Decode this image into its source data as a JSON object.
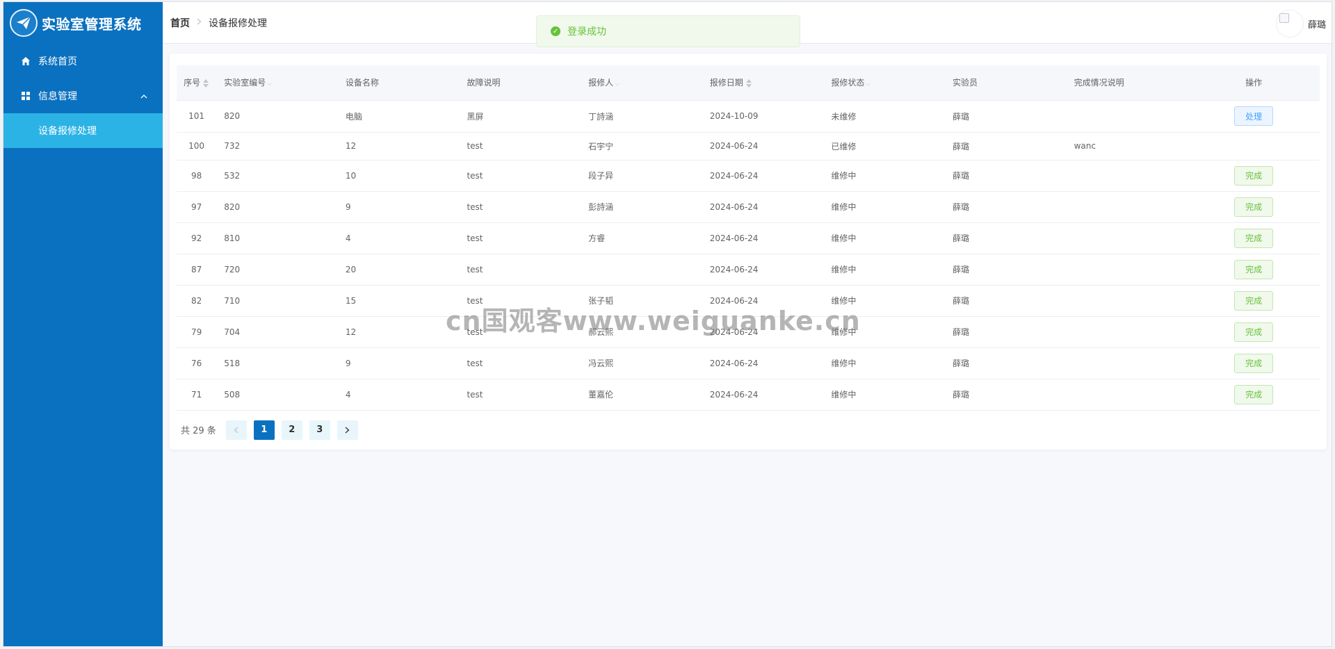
{
  "app": {
    "title": "实验室管理系统"
  },
  "sidebar": {
    "items": [
      {
        "label": "系统首页"
      },
      {
        "label": "信息管理"
      }
    ],
    "subitems": [
      {
        "label": "设备报修处理"
      }
    ]
  },
  "header": {
    "breadcrumb_home": "首页",
    "breadcrumb_current": "设备报修处理",
    "user_name": "薛璐"
  },
  "toast": {
    "message": "登录成功"
  },
  "table": {
    "columns": [
      "序号",
      "实验室编号",
      "设备名称",
      "故障说明",
      "报修人",
      "报修日期",
      "报修状态",
      "实验员",
      "完成情况说明",
      "操作"
    ],
    "rows": [
      {
        "id": "101",
        "lab": "820",
        "device": "电脑",
        "fault": "黑屏",
        "reporter": "丁詩涵",
        "date": "2024-10-09",
        "status": "未维修",
        "tech": "薛璐",
        "note": "",
        "action": "处理",
        "action_type": "blue"
      },
      {
        "id": "100",
        "lab": "732",
        "device": "12",
        "fault": "test",
        "reporter": "石宇宁",
        "date": "2024-06-24",
        "status": "已维修",
        "tech": "薛璐",
        "note": "wanc",
        "action": "",
        "action_type": "none"
      },
      {
        "id": "98",
        "lab": "532",
        "device": "10",
        "fault": "test",
        "reporter": "段子异",
        "date": "2024-06-24",
        "status": "维修中",
        "tech": "薛璐",
        "note": "",
        "action": "完成",
        "action_type": "green"
      },
      {
        "id": "97",
        "lab": "820",
        "device": "9",
        "fault": "test",
        "reporter": "彭詩涵",
        "date": "2024-06-24",
        "status": "维修中",
        "tech": "薛璐",
        "note": "",
        "action": "完成",
        "action_type": "green"
      },
      {
        "id": "92",
        "lab": "810",
        "device": "4",
        "fault": "test",
        "reporter": "方睿",
        "date": "2024-06-24",
        "status": "维修中",
        "tech": "薛璐",
        "note": "",
        "action": "完成",
        "action_type": "green"
      },
      {
        "id": "87",
        "lab": "720",
        "device": "20",
        "fault": "test",
        "reporter": "",
        "date": "2024-06-24",
        "status": "维修中",
        "tech": "薛璐",
        "note": "",
        "action": "完成",
        "action_type": "green"
      },
      {
        "id": "82",
        "lab": "710",
        "device": "15",
        "fault": "test",
        "reporter": "张子韬",
        "date": "2024-06-24",
        "status": "维修中",
        "tech": "薛璐",
        "note": "",
        "action": "完成",
        "action_type": "green"
      },
      {
        "id": "79",
        "lab": "704",
        "device": "12",
        "fault": "test",
        "reporter": "郝云熙",
        "date": "2024-06-24",
        "status": "维修中",
        "tech": "薛璐",
        "note": "",
        "action": "完成",
        "action_type": "green"
      },
      {
        "id": "76",
        "lab": "518",
        "device": "9",
        "fault": "test",
        "reporter": "冯云熙",
        "date": "2024-06-24",
        "status": "维修中",
        "tech": "薛璐",
        "note": "",
        "action": "完成",
        "action_type": "green"
      },
      {
        "id": "71",
        "lab": "508",
        "device": "4",
        "fault": "test",
        "reporter": "董嘉伦",
        "date": "2024-06-24",
        "status": "维修中",
        "tech": "薛璐",
        "note": "",
        "action": "完成",
        "action_type": "green"
      }
    ]
  },
  "pagination": {
    "total_label": "共 29 条",
    "pages": [
      "1",
      "2",
      "3"
    ],
    "current": "1"
  },
  "watermark": {
    "text": "cn国观客www.weiguanke.cn"
  },
  "colors": {
    "sidebar": "#0a71c0",
    "active_menu": "#2cb3e6",
    "success": "#67c23a",
    "primary": "#409eff"
  }
}
